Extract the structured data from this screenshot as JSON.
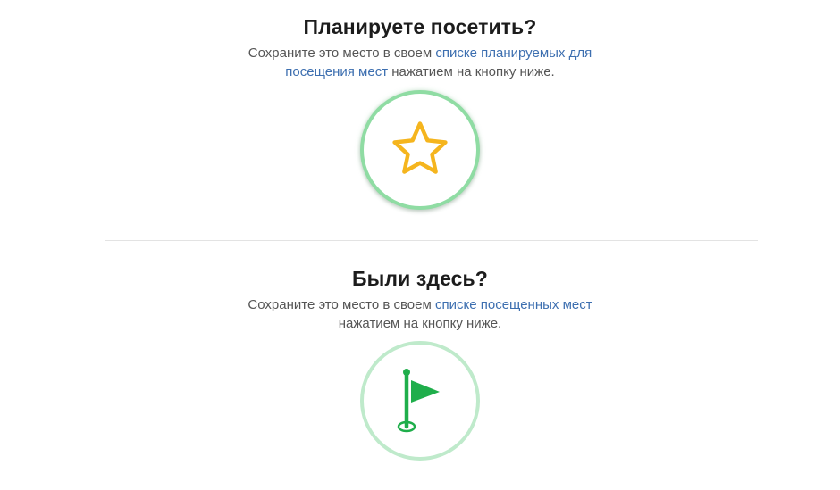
{
  "plan": {
    "title": "Планируете посетить?",
    "desc_before": "Сохраните это место в своем ",
    "link": "списке планируемых для посещения мест",
    "desc_after": " нажатием на кнопку ниже.",
    "button_icon": "star-icon"
  },
  "visited": {
    "title": "Были здесь?",
    "desc_before": "Сохраните это место в своем ",
    "link": "списке посещенных мест",
    "desc_after": " нажатием на кнопку ниже.",
    "button_icon": "flag-icon"
  },
  "colors": {
    "star": "#f5b51e",
    "flag": "#1fae4b",
    "link": "#3d6fb0",
    "ring_active": "#8fdca3",
    "ring_light": "#bfeacb"
  }
}
